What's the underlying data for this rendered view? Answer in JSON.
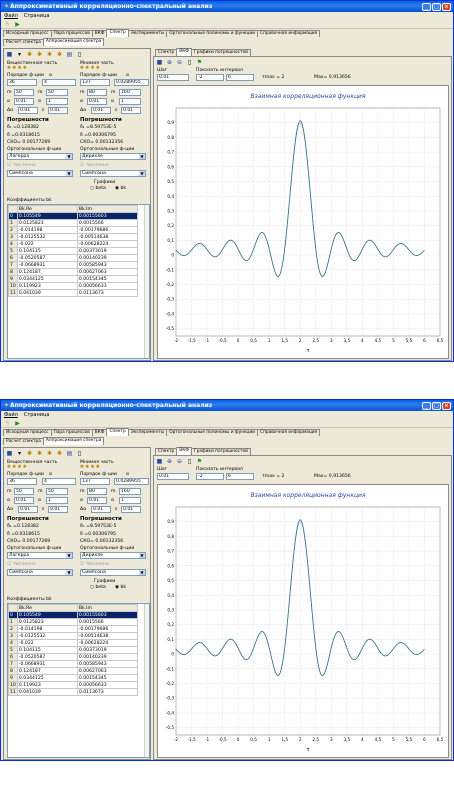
{
  "app": {
    "title": "Аппроксимативный корреляционно-спектральный анализ",
    "menu": [
      "Файл",
      "Страница"
    ],
    "main_tabs": [
      "Исходный процесс",
      "Пара процессов",
      "ВКФ",
      "Спектр",
      "Эксперименты",
      "Ортогональные полиномы и функции",
      "Справочная информация"
    ],
    "active_main_tab": "Спектр",
    "sub_tabs": [
      "Расчет спектра",
      "Аппроксимация спектра"
    ],
    "active_sub_tab": "Аппроксимация спектра"
  },
  "left": {
    "real_label": "Вещественная часть",
    "imag_label": "Мнимая часть",
    "order_label": "Порядок ф-ции",
    "alpha_label": "α",
    "real": {
      "order": "36",
      "alpha": "4",
      "m_val": "50",
      "m2_val": "50",
      "a_val": "0.01",
      "a2_val": "1",
      "d_val": "0.01",
      "d2_val": "0.01"
    },
    "imag": {
      "order": "137",
      "alpha": "0.0289955",
      "m_val": "80",
      "m2_val": "160",
      "a_val": "0.01",
      "a2_val": "1",
      "d_val": "0.01",
      "d2_val": "0.01"
    },
    "m_label": "m",
    "mv_label": "m",
    "a_label": "α",
    "d_label": "Δα",
    "eps_label": "ε",
    "errors_label": "Погрешности",
    "real_errors": [
      "δ₁ =0.128382",
      "δ  =0.0318615",
      "СКО= 0.00177269"
    ],
    "imag_errors": [
      "δ₁ =8.59753E-5",
      "δ  =0.00306795",
      "СКО= 0.00132356"
    ],
    "orth_label": "Ортогональные ф-ции",
    "real_orth": "Лагерра",
    "imag_orth": "Дирихле",
    "method_label": "Численно",
    "real_method": "Симпсона",
    "imag_method": "Симпсона",
    "graphs_label": "Графики",
    "radio_beta": "beta",
    "radio_bk": "bk",
    "coef_label": "Коэффициенты bk",
    "coef_headers": [
      "",
      "Bk.Re",
      "Bk.Im"
    ],
    "coef_rows": [
      [
        "0",
        "0.105549",
        "0.00155603"
      ],
      [
        "1",
        "0.0125823",
        "0.0015566"
      ],
      [
        "2",
        "-0.014198",
        "-0.00179686"
      ],
      [
        "3",
        "-0.0125532",
        "-0.00514638"
      ],
      [
        "4",
        "-0.022",
        "-0.00628224"
      ],
      [
        "5",
        "0.104115",
        "0.00373019"
      ],
      [
        "6",
        "-0.0520587",
        "0.00140239"
      ],
      [
        "7",
        "-0.0668931",
        "0.00585943"
      ],
      [
        "8",
        "0.124187",
        "0.00627063"
      ],
      [
        "9",
        "0.0344125",
        "0.00154345"
      ],
      [
        "10",
        "0.119923",
        "0.00056633"
      ],
      [
        "11",
        "0.041039",
        "0.0113673"
      ]
    ]
  },
  "right": {
    "tabs": [
      "Спектр",
      "ВКФ",
      "Графики погрешностей"
    ],
    "active_tab": "ВКФ",
    "step_label": "Шаг",
    "step_value": "0.01",
    "interval_label": "Показать интервал",
    "interval_from": "-2",
    "interval_to": "6",
    "tau_label": "τmax = 2",
    "max_label": "Max= 0,913656"
  },
  "chart_data": {
    "type": "line",
    "title": "Взаимная корреляционная функция",
    "xlabel": "τ",
    "ylabel": "",
    "xlim": [
      -2,
      6.5
    ],
    "ylim": [
      -0.55,
      1.0
    ],
    "x_ticks": [
      "-2",
      "-1,5",
      "-1",
      "-0,5",
      "0",
      "0,5",
      "1",
      "1,5",
      "2",
      "2,5",
      "3",
      "3,5",
      "4",
      "4,5",
      "5",
      "5,5",
      "6",
      "6,5"
    ],
    "y_ticks": [
      "-0,5",
      "-0,4",
      "-0,3",
      "-0,2",
      "-0,1",
      "0",
      "0,1",
      "0,2",
      "0,3",
      "0,4",
      "0,5",
      "0,6",
      "0,7",
      "0,8",
      "0,9"
    ],
    "grid": true,
    "series_color": "#4a8a8a",
    "series_color_2": "#2a4aa0",
    "description": "damped sinc-like correlation function peaking at τ=2",
    "series": [
      {
        "x": [
          -2,
          -1.5,
          -1,
          -0.6,
          -0.3,
          0,
          0.3,
          0.6,
          1.0,
          1.3,
          1.55,
          1.8,
          2.0,
          2.2,
          2.45,
          2.7,
          3.0,
          3.4,
          3.7,
          4.0,
          4.3,
          4.6,
          5.0,
          5.4,
          6.0
        ],
        "y": [
          0.0,
          0.01,
          -0.1,
          0.05,
          0.18,
          0.0,
          -0.2,
          0.22,
          0.55,
          -0.05,
          -0.52,
          0.2,
          0.913,
          0.2,
          -0.52,
          -0.05,
          0.55,
          0.22,
          -0.2,
          0.0,
          0.18,
          0.05,
          -0.1,
          0.01,
          0.0
        ]
      }
    ]
  }
}
